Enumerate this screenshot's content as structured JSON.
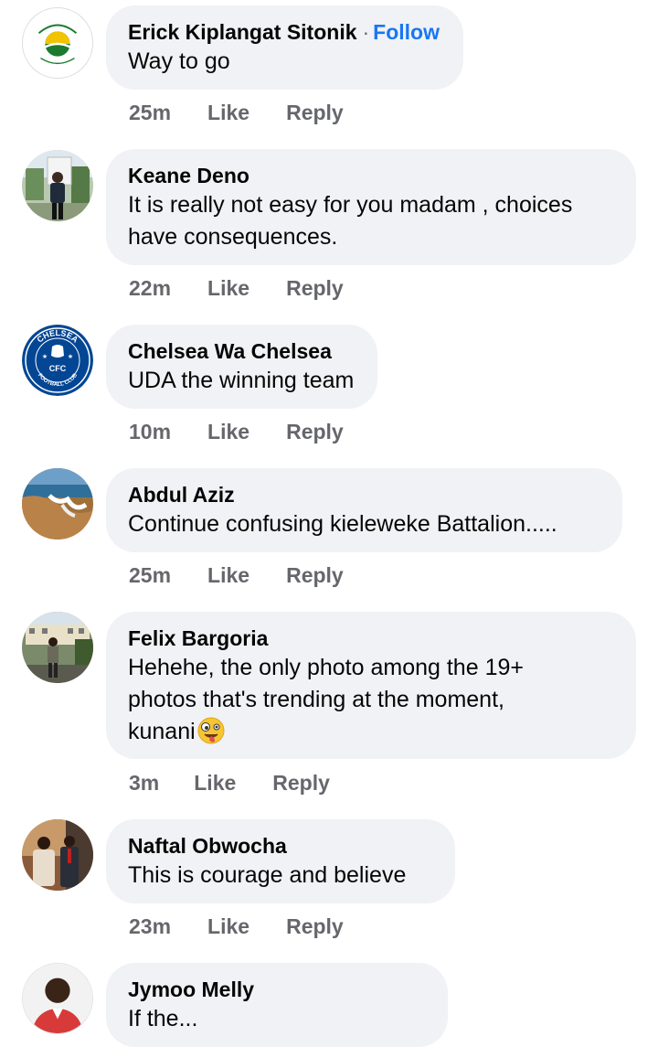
{
  "comments": [
    {
      "name": "Erick Kiplangat Sitonik",
      "follow_separator": "·",
      "follow_label": "Follow",
      "text": "Way to go",
      "time": "25m",
      "like_label": "Like",
      "reply_label": "Reply",
      "avatar_icon": "logo-badge-icon"
    },
    {
      "name": "Keane Deno",
      "text": "It is really not easy for you madam , choices\nhave consequences.",
      "time": "22m",
      "like_label": "Like",
      "reply_label": "Reply",
      "avatar_icon": "person-photo-icon"
    },
    {
      "name": "Chelsea Wa Chelsea",
      "text": "UDA the winning team",
      "time": "10m",
      "like_label": "Like",
      "reply_label": "Reply",
      "avatar_icon": "chelsea-crest-icon",
      "avatar_logo_text": [
        "CHELSEA",
        "CFC",
        "FOOTBALL CLUB"
      ]
    },
    {
      "name": "Abdul Aziz",
      "text": "Continue confusing kieleweke Battalion.....",
      "time": "25m",
      "like_label": "Like",
      "reply_label": "Reply",
      "avatar_icon": "beach-photo-icon"
    },
    {
      "name": "Felix Bargoria",
      "text": "Hehehe, the only photo among the 19+\nphotos that's trending at the moment,\nkunani",
      "emoji": "zany-face-emoji",
      "time": "3m",
      "like_label": "Like",
      "reply_label": "Reply",
      "avatar_icon": "person-outdoor-photo-icon"
    },
    {
      "name": "Naftal Obwocha",
      "text": "This is courage and believe",
      "time": "23m",
      "like_label": "Like",
      "reply_label": "Reply",
      "avatar_icon": "two-people-photo-icon"
    },
    {
      "name": "Jymoo Melly",
      "text": "If the...",
      "avatar_icon": "person-portrait-icon"
    }
  ],
  "colors": {
    "bubble_bg": "#f0f2f5",
    "meta_text": "#65676b",
    "follow_link": "#1877f2",
    "name_text": "#050505"
  }
}
